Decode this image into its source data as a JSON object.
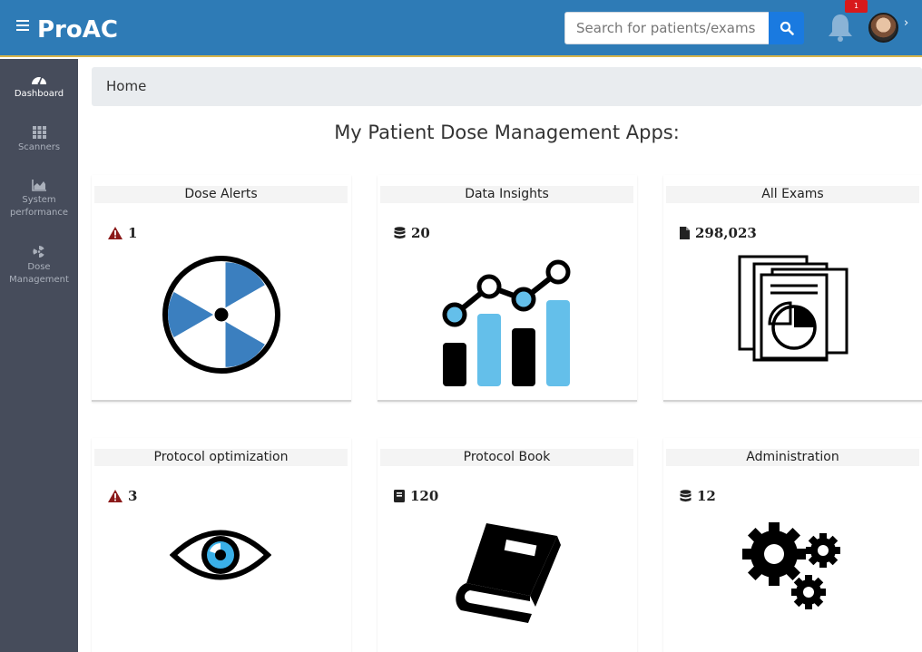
{
  "header": {
    "logo_text": "ProAC",
    "search_placeholder": "Search for patients/exams",
    "notification_count": "1"
  },
  "sidebar": {
    "items": [
      {
        "label_line1": "Dashboard",
        "label_line2": "",
        "icon": "dashboard-icon",
        "active": true
      },
      {
        "label_line1": "Scanners",
        "label_line2": "",
        "icon": "grid-icon",
        "active": false
      },
      {
        "label_line1": "System",
        "label_line2": "performance",
        "icon": "area-chart-icon",
        "active": false
      },
      {
        "label_line1": "Dose",
        "label_line2": "Management",
        "icon": "radiation-icon",
        "active": false
      }
    ]
  },
  "breadcrumb": "Home",
  "page_title": "My Patient Dose Management Apps:",
  "cards": [
    {
      "title": "Dose Alerts",
      "count": "1",
      "count_icon": "warning-icon",
      "illustration": "radiation-symbol-icon"
    },
    {
      "title": "Data Insights",
      "count": "20",
      "count_icon": "database-icon",
      "illustration": "bar-line-chart-icon"
    },
    {
      "title": "All Exams",
      "count": "298,023",
      "count_icon": "file-icon",
      "illustration": "documents-icon"
    },
    {
      "title": "Protocol optimization",
      "count": "3",
      "count_icon": "warning-icon",
      "illustration": "eye-icon"
    },
    {
      "title": "Protocol Book",
      "count": "120",
      "count_icon": "book-small-icon",
      "illustration": "book-icon"
    },
    {
      "title": "Administration",
      "count": "12",
      "count_icon": "database-icon",
      "illustration": "gears-icon"
    }
  ],
  "colors": {
    "header": "#2e7bb6",
    "sidebar": "#464c5b",
    "accent_blue": "#3b7fbf",
    "light_blue": "#64bfea",
    "alert_red": "#8b1a1a",
    "search_button": "#1a7ae0"
  }
}
